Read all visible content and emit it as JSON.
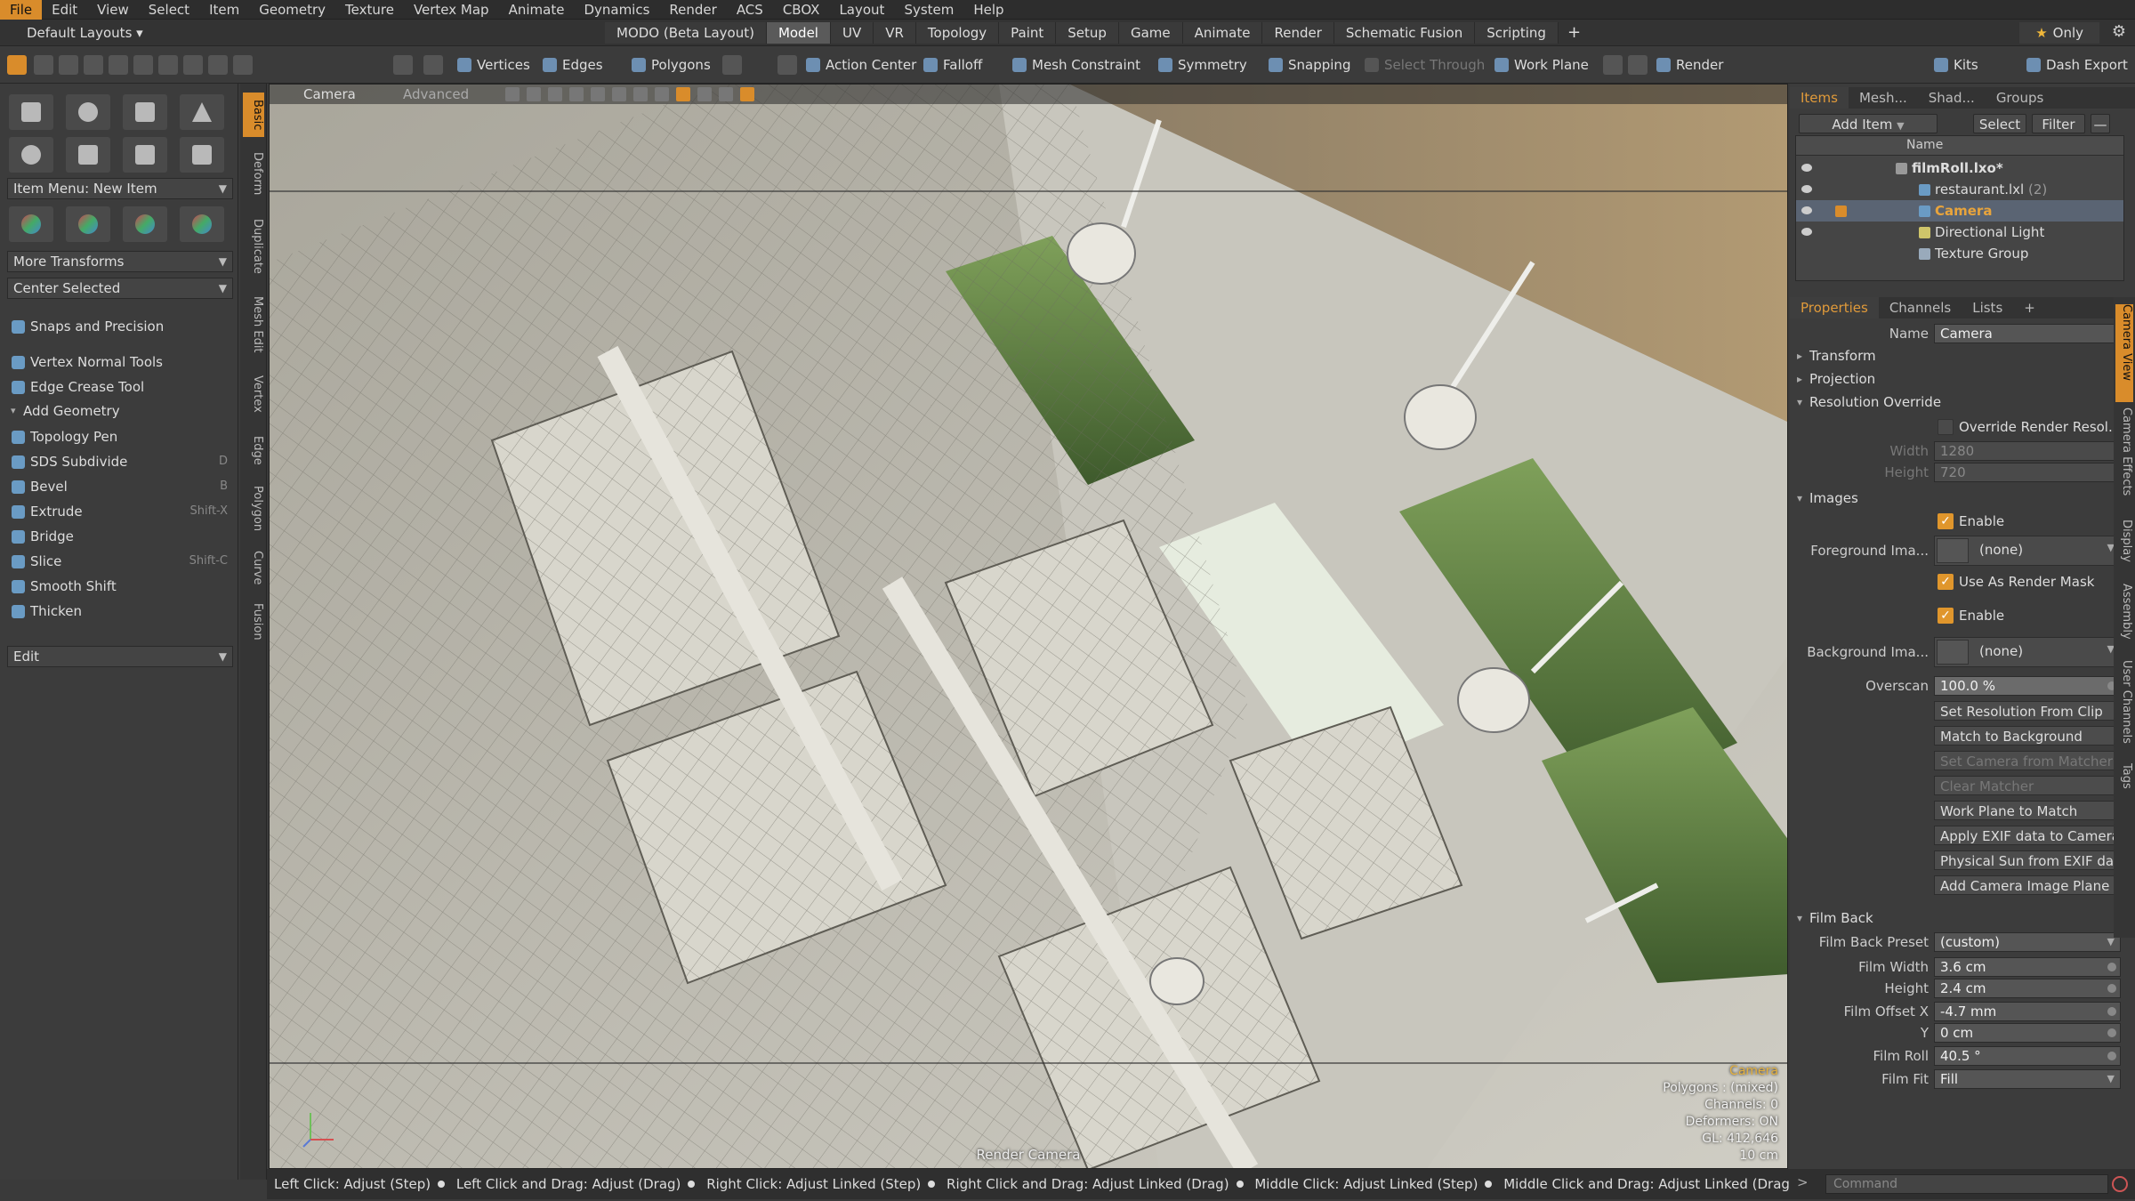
{
  "menubar": {
    "items": [
      "File",
      "Edit",
      "View",
      "Select",
      "Item",
      "Geometry",
      "Texture",
      "Vertex Map",
      "Animate",
      "Dynamics",
      "Render",
      "ACS",
      "CBOX",
      "Layout",
      "System",
      "Help"
    ],
    "active_index": 0
  },
  "layoutbar": {
    "layout_select": "Default Layouts ▾",
    "tabs": [
      "MODO (Beta Layout)",
      "Model",
      "UV",
      "VR",
      "Topology",
      "Paint",
      "Setup",
      "Game",
      "Animate",
      "Render",
      "Schematic Fusion",
      "Scripting"
    ],
    "active_tab": "Model",
    "plus": "+",
    "only_label": "Only"
  },
  "toolbar": {
    "vertices": "Vertices",
    "edges": "Edges",
    "polygons": "Polygons",
    "action_center": "Action Center",
    "falloff": "Falloff",
    "mesh_constraint": "Mesh Constraint",
    "symmetry": "Symmetry",
    "snapping": "Snapping",
    "select_through": "Select Through",
    "work_plane": "Work Plane",
    "render": "Render",
    "kits": "Kits",
    "dash_export": "Dash Export"
  },
  "leftpanel": {
    "item_menu": "Item Menu: New Item",
    "more_transforms": "More Transforms",
    "center_selected": "Center Selected",
    "snaps_and_precision": "Snaps and Precision",
    "vertex_normal_tools": "Vertex Normal Tools",
    "edge_crease_tool": "Edge Crease Tool",
    "add_geometry": "Add Geometry",
    "tools": [
      {
        "label": "Topology Pen",
        "shortcut": ""
      },
      {
        "label": "SDS Subdivide",
        "shortcut": "D"
      },
      {
        "label": "Bevel",
        "shortcut": "B"
      },
      {
        "label": "Extrude",
        "shortcut": "Shift-X"
      },
      {
        "label": "Bridge",
        "shortcut": ""
      },
      {
        "label": "Slice",
        "shortcut": "Shift-C"
      },
      {
        "label": "Smooth Shift",
        "shortcut": ""
      },
      {
        "label": "Thicken",
        "shortcut": ""
      }
    ],
    "edit_dropdown": "Edit"
  },
  "vtabs": [
    "Basic",
    "Deform",
    "Duplicate",
    "Mesh Edit",
    "Vertex",
    "Edge",
    "Polygon",
    "Curve",
    "Fusion"
  ],
  "viewport": {
    "tab_camera": "Camera",
    "tab_advanced": "Advanced",
    "render_camera": "Render Camera",
    "info": {
      "camera": "Camera",
      "polygons": "Polygons : (mixed)",
      "channels": "Channels: 0",
      "deformers": "Deformers: ON",
      "gl": "GL: 412,646",
      "scale": "10 cm"
    }
  },
  "statusbar": {
    "hints": [
      "Left Click: Adjust (Step)",
      "Left Click and Drag: Adjust (Drag)",
      "Right Click: Adjust Linked (Step)",
      "Right Click and Drag: Adjust Linked (Drag)",
      "Middle Click: Adjust Linked (Step)",
      "Middle Click and Drag: Adjust Linked (Drag)"
    ],
    "command_placeholder": "Command",
    "prompt": ">"
  },
  "items_panel": {
    "tabs": [
      "Items",
      "Mesh...",
      "Shad...",
      "Groups"
    ],
    "add_item": "Add Item",
    "select": "Select",
    "filter": "Filter",
    "name_header": "Name",
    "rows": [
      {
        "label": "filmRoll.lxo*",
        "count": ""
      },
      {
        "label": "restaurant.lxl",
        "count": "(2)"
      },
      {
        "label": "Camera",
        "count": ""
      },
      {
        "label": "Directional Light",
        "count": ""
      },
      {
        "label": "Texture Group",
        "count": ""
      }
    ]
  },
  "properties": {
    "tabs": [
      "Properties",
      "Channels",
      "Lists",
      "+"
    ],
    "name_label": "Name",
    "name_value": "Camera",
    "transform": "Transform",
    "projection": "Projection",
    "resolution_override": "Resolution Override",
    "override_render_resol": "Override Render Resol...",
    "width_label": "Width",
    "width_value": "1280",
    "height_label": "Height",
    "height_value": "720",
    "images": "Images",
    "enable": "Enable",
    "foreground_image": "Foreground Ima...",
    "none": "(none)",
    "use_as_render_mask": "Use As Render Mask",
    "background_image": "Background Ima...",
    "overscan_label": "Overscan",
    "overscan_value": "100.0 %",
    "buttons": [
      {
        "label": "Set Resolution From Clip",
        "enabled": true
      },
      {
        "label": "Match to Background",
        "enabled": true
      },
      {
        "label": "Set Camera from Matcher",
        "enabled": false
      },
      {
        "label": "Clear Matcher",
        "enabled": false
      },
      {
        "label": "Work Plane to Match",
        "enabled": true
      },
      {
        "label": "Apply EXIF data to Camera ...",
        "enabled": true
      },
      {
        "label": "Physical Sun from EXIF data",
        "enabled": true
      },
      {
        "label": "Add Camera Image Plane",
        "enabled": true
      }
    ],
    "film_back": "Film Back",
    "film_back_preset_label": "Film Back Preset",
    "film_back_preset_value": "(custom)",
    "film_width_label": "Film Width",
    "film_width_value": "3.6 cm",
    "film_height_label": "Height",
    "film_height_value": "2.4 cm",
    "film_offset_x_label": "Film Offset X",
    "film_offset_x_value": "-4.7 mm",
    "film_offset_y_label": "Y",
    "film_offset_y_value": "0 cm",
    "film_roll_label": "Film Roll",
    "film_roll_value": "40.5 °",
    "film_fit_label": "Film Fit",
    "film_fit_value": "Fill"
  },
  "rp_vtabs": [
    "Camera View",
    "Camera Effects",
    "Display",
    "Assembly",
    "User Channels",
    "Tags"
  ]
}
